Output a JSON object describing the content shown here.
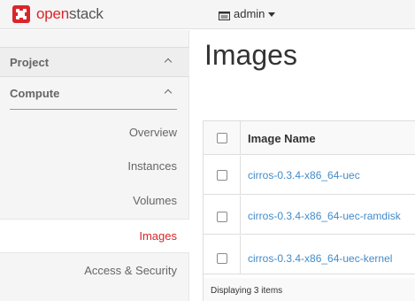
{
  "topbar": {
    "brand_prefix": "open",
    "brand_suffix": "stack",
    "user": "admin",
    "colors": {
      "brand": "#d9262b",
      "link": "#428bca"
    }
  },
  "sidebar": {
    "project_label": "Project",
    "compute_label": "Compute",
    "items": [
      {
        "label": "Overview",
        "active": false
      },
      {
        "label": "Instances",
        "active": false
      },
      {
        "label": "Volumes",
        "active": false
      },
      {
        "label": "Images",
        "active": true
      },
      {
        "label": "Access & Security",
        "active": false
      }
    ]
  },
  "main": {
    "title": "Images",
    "table": {
      "column_header": "Image Name",
      "rows": [
        {
          "name": "cirros-0.3.4-x86_64-uec"
        },
        {
          "name": "cirros-0.3.4-x86_64-uec-ramdisk"
        },
        {
          "name": "cirros-0.3.4-x86_64-uec-kernel"
        }
      ],
      "footer": "Displaying 3 items"
    }
  }
}
